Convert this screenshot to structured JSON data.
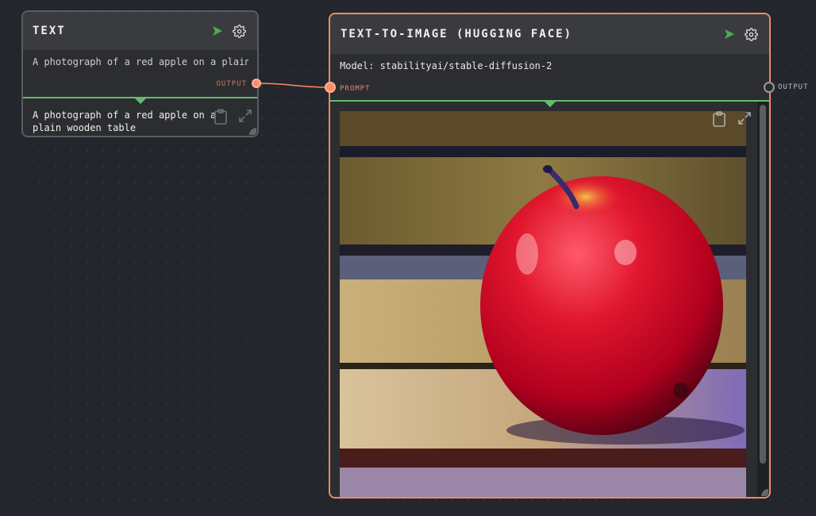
{
  "text_node": {
    "title": "TEXT",
    "input_value": "A photograph of a red apple on a plain",
    "output_label": "OUTPUT",
    "output_value": "A photograph of a red apple on a plain wooden table"
  },
  "tti_node": {
    "title": "TEXT-TO-IMAGE (HUGGING FACE)",
    "model_line": "Model: stabilityai/stable-diffusion-2",
    "prompt_label": "PROMPT",
    "output_label": "OUTPUT",
    "image_subject": "red apple on wooden table"
  },
  "icons": {
    "run": "play-icon",
    "settings": "gear-icon",
    "copy": "clipboard-icon",
    "expand": "expand-icon"
  },
  "colors": {
    "canvas": "#23262d",
    "accent_connection": "#ff8a65",
    "run_green": "#4caf50",
    "divider_green": "#66bb6a",
    "selected_border": "#f08966"
  }
}
